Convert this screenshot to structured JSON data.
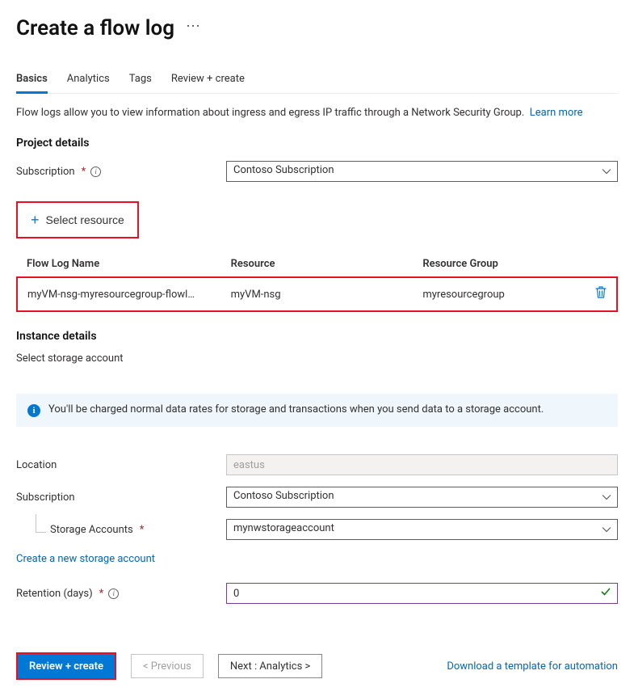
{
  "title": "Create a flow log",
  "tabs": [
    "Basics",
    "Analytics",
    "Tags",
    "Review + create"
  ],
  "activeTab": 0,
  "description": "Flow logs allow you to view information about ingress and egress IP traffic through a Network Security Group.",
  "learnMore": "Learn more",
  "project": {
    "heading": "Project details",
    "subscriptionLabel": "Subscription",
    "subscriptionValue": "Contoso Subscription"
  },
  "selectResourceLabel": "Select resource",
  "resourceTable": {
    "headers": [
      "Flow Log Name",
      "Resource",
      "Resource Group"
    ],
    "row": {
      "flowLogName": "myVM-nsg-myresourcegroup-flowl…",
      "resource": "myVM-nsg",
      "resourceGroup": "myresourcegroup"
    }
  },
  "instance": {
    "heading": "Instance details",
    "subHeading": "Select storage account",
    "bannerText": "You'll be charged normal data rates for storage and transactions when you send data to a storage account.",
    "locationLabel": "Location",
    "locationValue": "eastus",
    "subscriptionLabel": "Subscription",
    "subscriptionValue": "Contoso Subscription",
    "storageAccountsLabel": "Storage Accounts",
    "storageAccountsValue": "mynwstorageaccount",
    "newStorageLink": "Create a new storage account",
    "retentionLabel": "Retention (days)",
    "retentionValue": "0"
  },
  "footer": {
    "review": "Review + create",
    "prev": "< Previous",
    "next": "Next : Analytics >",
    "download": "Download a template for automation"
  }
}
